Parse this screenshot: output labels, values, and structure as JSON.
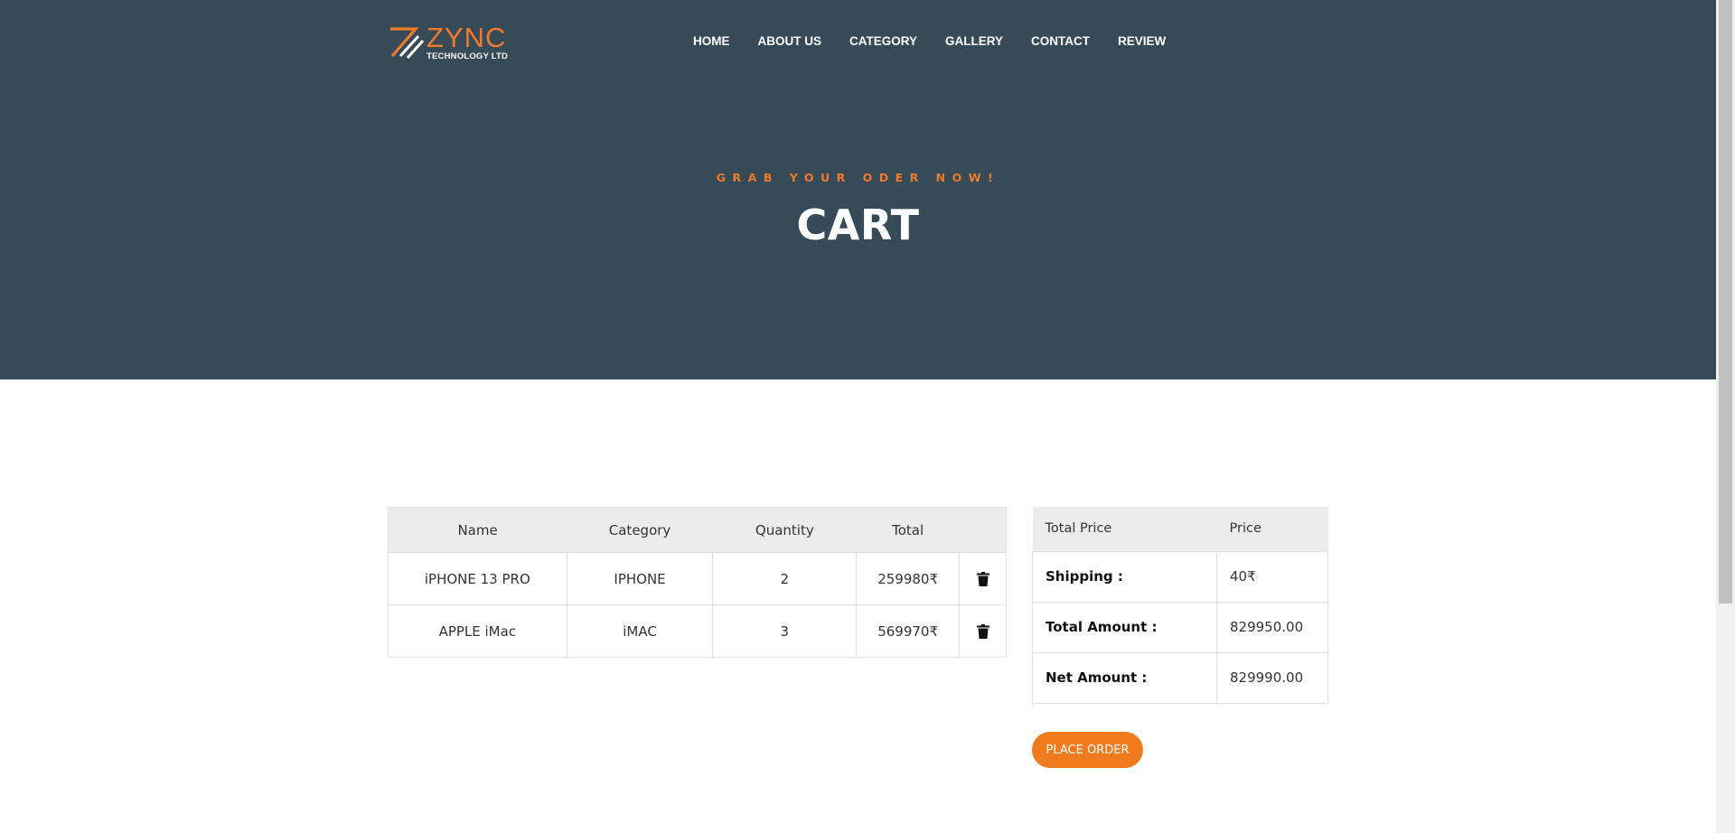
{
  "brand": {
    "name": "ZYNC",
    "tagline": "TECHNOLOGY LTD",
    "accent_color": "#f07b2a"
  },
  "nav": {
    "items": [
      {
        "label": "HOME"
      },
      {
        "label": "ABOUT US"
      },
      {
        "label": "CATEGORY"
      },
      {
        "label": "GALLERY"
      },
      {
        "label": "CONTACT"
      },
      {
        "label": "REVIEW"
      }
    ]
  },
  "hero": {
    "subtitle": "GRAB YOUR ODER NOW!",
    "title": "CART",
    "background_color": "#374a57"
  },
  "cart": {
    "headers": {
      "name": "Name",
      "category": "Category",
      "quantity": "Quantity",
      "total": "Total"
    },
    "rows": [
      {
        "name": "iPHONE 13 PRO",
        "category": "IPHONE",
        "quantity": "2",
        "total": "259980₹",
        "delete_icon": "trash-icon"
      },
      {
        "name": "APPLE iMac",
        "category": "iMAC",
        "quantity": "3",
        "total": "569970₹",
        "delete_icon": "trash-icon"
      }
    ]
  },
  "summary": {
    "headers": {
      "label": "Total Price",
      "value": "Price"
    },
    "rows": [
      {
        "label": "Shipping :",
        "value": "40₹"
      },
      {
        "label": "Total Amount :",
        "value": "829950.00"
      },
      {
        "label": "Net Amount :",
        "value": "829990.00"
      }
    ]
  },
  "actions": {
    "place_order": "PLACE ORDER",
    "button_color": "#f07b1e"
  }
}
